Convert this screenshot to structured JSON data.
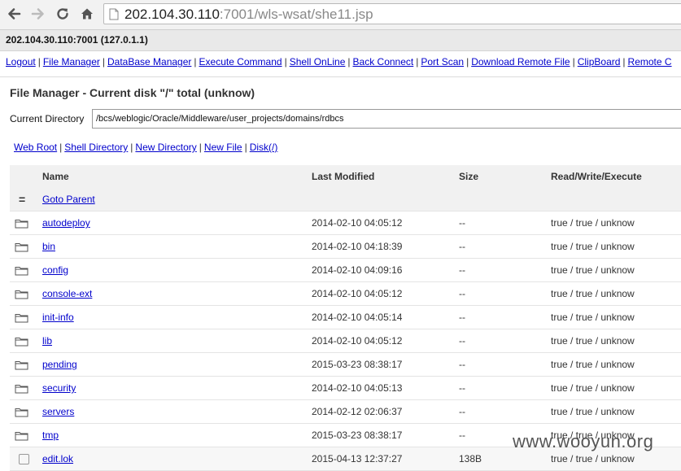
{
  "browser": {
    "url_host": "202.104.30.110",
    "url_rest": ":7001/wls-wsat/she11.jsp"
  },
  "host_bar": "202.104.30.110:7001 (127.0.1.1)",
  "menu": [
    "Logout",
    "File Manager",
    "DataBase Manager",
    "Execute Command",
    "Shell OnLine",
    "Back Connect",
    "Port Scan",
    "Download Remote File",
    "ClipBoard",
    "Remote C"
  ],
  "page_title": "File Manager - Current disk \"/\" total (unknow)",
  "current_directory": {
    "label": "Current Directory",
    "value": "/bcs/weblogic/Oracle/Middleware/user_projects/domains/rdbcs"
  },
  "sublinks": [
    "Web Root",
    "Shell Directory",
    "New Directory",
    "New File",
    "Disk(/)"
  ],
  "table": {
    "headers": {
      "name": "Name",
      "modified": "Last Modified",
      "size": "Size",
      "rwx": "Read/Write/Execute"
    },
    "parent_icon": "=",
    "parent_label": "Goto Parent",
    "rows": [
      {
        "type": "folder",
        "name": "autodeploy",
        "modified": "2014-02-10 04:05:12",
        "size": "--",
        "rwx": "true / true / unknow"
      },
      {
        "type": "folder",
        "name": "bin",
        "modified": "2014-02-10 04:18:39",
        "size": "--",
        "rwx": "true / true / unknow"
      },
      {
        "type": "folder",
        "name": "config",
        "modified": "2014-02-10 04:09:16",
        "size": "--",
        "rwx": "true / true / unknow"
      },
      {
        "type": "folder",
        "name": "console-ext",
        "modified": "2014-02-10 04:05:12",
        "size": "--",
        "rwx": "true / true / unknow"
      },
      {
        "type": "folder",
        "name": "init-info",
        "modified": "2014-02-10 04:05:14",
        "size": "--",
        "rwx": "true / true / unknow"
      },
      {
        "type": "folder",
        "name": "lib",
        "modified": "2014-02-10 04:05:12",
        "size": "--",
        "rwx": "true / true / unknow"
      },
      {
        "type": "folder",
        "name": "pending",
        "modified": "2015-03-23 08:38:17",
        "size": "--",
        "rwx": "true / true / unknow"
      },
      {
        "type": "folder",
        "name": "security",
        "modified": "2014-02-10 04:05:13",
        "size": "--",
        "rwx": "true / true / unknow"
      },
      {
        "type": "folder",
        "name": "servers",
        "modified": "2014-02-12 02:06:37",
        "size": "--",
        "rwx": "true / true / unknow"
      },
      {
        "type": "folder",
        "name": "tmp",
        "modified": "2015-03-23 08:38:17",
        "size": "--",
        "rwx": "true / true / unknow"
      },
      {
        "type": "file",
        "name": "edit.lok",
        "modified": "2015-04-13 12:37:27",
        "size": "138B",
        "rwx": "true / true / unknow"
      }
    ]
  },
  "watermark": "www.wooyun.org"
}
